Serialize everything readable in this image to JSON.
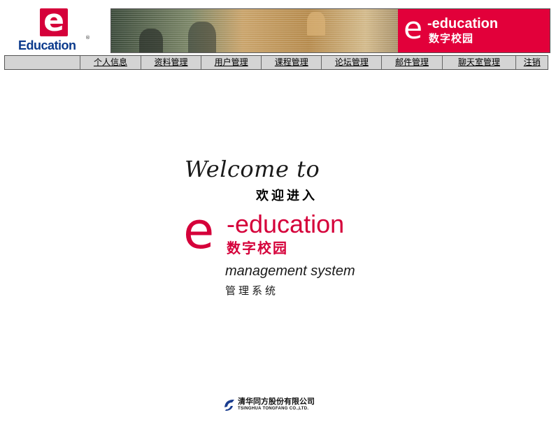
{
  "header": {
    "logo_letter": "e",
    "logo_text": "Education",
    "logo_registered": "®",
    "banner_letter": "e",
    "banner_title": "-education",
    "banner_subtitle": "数字校园"
  },
  "nav": {
    "items": [
      {
        "label": "个人信息"
      },
      {
        "label": "资料管理"
      },
      {
        "label": "用户管理"
      },
      {
        "label": "课程管理"
      },
      {
        "label": "论坛管理"
      },
      {
        "label": "邮件管理"
      },
      {
        "label": "聊天室管理"
      },
      {
        "label": "注销"
      }
    ]
  },
  "splash": {
    "welcome": "Welcome to",
    "welcome_cn": "欢迎进入",
    "brand_letter": "e",
    "brand": "-education",
    "brand_cn": "数字校园",
    "subtitle": "management system",
    "subtitle_cn": "管理系统"
  },
  "footer": {
    "company_cn": "清华同方股份有限公司",
    "company_en": "TSINGHUA TONGFANG CO.,LTD."
  },
  "colors": {
    "brand_red": "#d5003a",
    "logo_blue": "#0b3a8c",
    "nav_bg": "#d4d4d4"
  }
}
